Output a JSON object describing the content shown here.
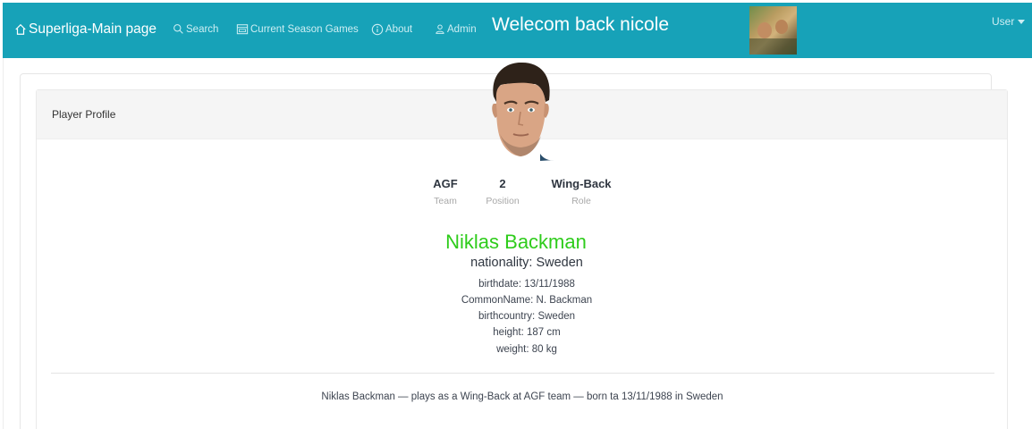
{
  "navbar": {
    "brand": "Superliga-Main page",
    "links": {
      "search": "Search",
      "games": "Current Season Games",
      "about": "About",
      "admin": "Admin"
    },
    "welcome": "Welecom back nicole",
    "user_menu": "User"
  },
  "card": {
    "header_title": "Player Profile"
  },
  "player": {
    "stats": {
      "team": {
        "value": "AGF",
        "label": "Team"
      },
      "position": {
        "value": "2",
        "label": "Position"
      },
      "role": {
        "value": "Wing-Back",
        "label": "Role"
      }
    },
    "name": "Niklas Backman",
    "nationality": "nationality: Sweden",
    "details": {
      "birthdate": "birthdate: 13/11/1988",
      "common_name": "CommonName: N. Backman",
      "birthcountry": "birthcountry: Sweden",
      "height": "height: 187 cm",
      "weight": "weight: 80 kg"
    },
    "summary": "Niklas Backman — plays as a Wing-Back at AGF team — born ta 13/11/1988 in Sweden"
  },
  "colors": {
    "navbar_bg": "#17a2b8",
    "player_name": "#2ecc1b"
  },
  "icons": {
    "brand": "home-icon",
    "search": "search-icon",
    "games": "calendar-icon",
    "about": "info-icon",
    "admin": "user-icon"
  }
}
